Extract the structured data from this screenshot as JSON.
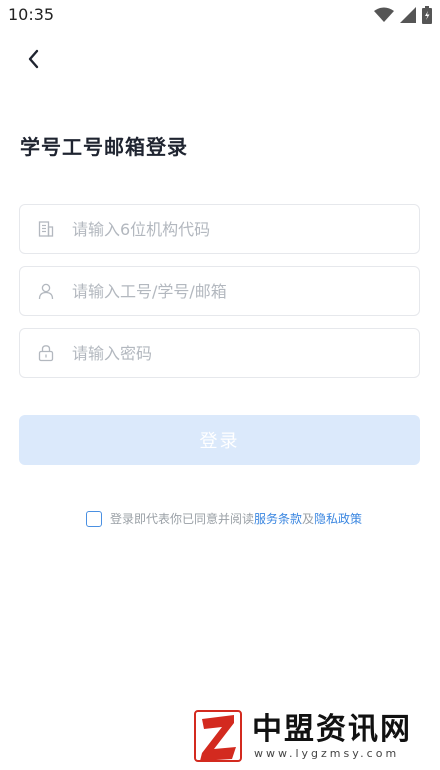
{
  "status_bar": {
    "time": "10:35",
    "icons": [
      "wifi-icon",
      "signal-icon",
      "battery-icon"
    ]
  },
  "header": {
    "back_icon": "chevron-left-icon",
    "title": "学号工号邮箱登录"
  },
  "form": {
    "org_code": {
      "placeholder": "请输入6位机构代码",
      "value": "",
      "icon": "building-icon"
    },
    "account": {
      "placeholder": "请输入工号/学号/邮箱",
      "value": "",
      "icon": "user-icon"
    },
    "password": {
      "placeholder": "请输入密码",
      "value": "",
      "icon": "lock-icon"
    },
    "login_label": "登录"
  },
  "agreement": {
    "prefix": "登录即代表你已同意并阅读",
    "terms_link": "服务条款",
    "conjunction": "及",
    "privacy_link": "隐私政策",
    "checked": false
  },
  "watermark": {
    "title": "中盟资讯网",
    "subtitle": "www.lygzmsy.com"
  },
  "colors": {
    "accent": "#3a86e0",
    "button_disabled": "#dbe9fb",
    "border": "#e6e8ec",
    "placeholder": "#b3b8bf"
  }
}
